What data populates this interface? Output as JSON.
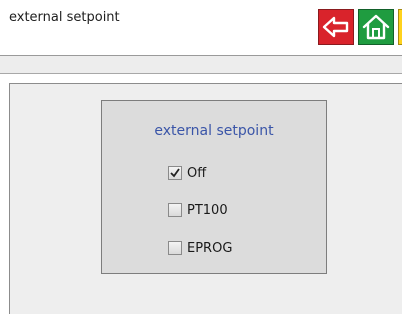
{
  "header": {
    "title": "external setpoint",
    "help_label": "?"
  },
  "panel": {
    "title": "external setpoint",
    "options": [
      {
        "label": "Off",
        "checked": true
      },
      {
        "label": "PT100",
        "checked": false
      },
      {
        "label": "EPROG",
        "checked": false
      }
    ]
  },
  "icons": {
    "back": "arrow-left-icon",
    "home": "home-icon",
    "help": "question-icon",
    "check": "checkmark-icon"
  },
  "colors": {
    "back_button": "#d9232b",
    "home_button": "#1f9c40",
    "help_button": "#ffd21c",
    "panel_title": "#3a55a8"
  }
}
